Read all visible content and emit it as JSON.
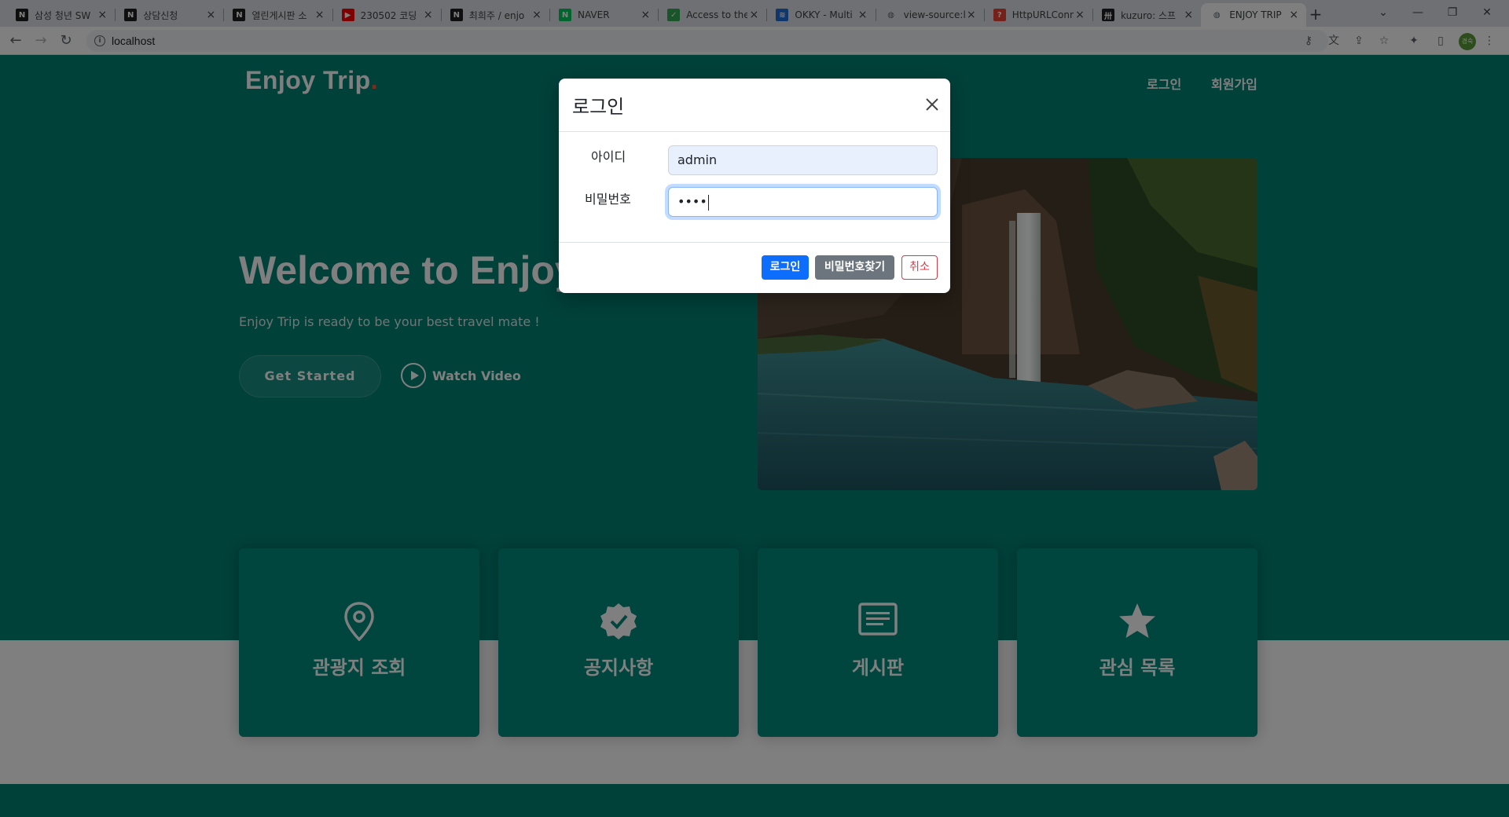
{
  "browser": {
    "tabs": [
      {
        "title": "삼성 청년 SW",
        "favicon": "notion-icon",
        "active": false
      },
      {
        "title": "상담신청",
        "favicon": "notion-icon",
        "active": false
      },
      {
        "title": "열린게시판 소",
        "favicon": "notion-icon",
        "active": false
      },
      {
        "title": "230502 코딩",
        "favicon": "youtube-icon",
        "active": false
      },
      {
        "title": "최희주 / enjo",
        "favicon": "notion-icon",
        "active": false
      },
      {
        "title": "NAVER",
        "favicon": "naver-icon",
        "active": false
      },
      {
        "title": "Access to the",
        "favicon": "check-icon",
        "active": false
      },
      {
        "title": "OKKY - Multi",
        "favicon": "okky-icon",
        "active": false
      },
      {
        "title": "view-source:l",
        "favicon": "globe-icon",
        "active": false
      },
      {
        "title": "HttpURLConn",
        "favicon": "question-icon",
        "active": false
      },
      {
        "title": "kuzuro: 스프",
        "favicon": "blog-icon",
        "active": false
      },
      {
        "title": "ENJOY TRIP",
        "favicon": "globe-icon",
        "active": true
      }
    ],
    "url": "localhost",
    "profile_initials": "경숙"
  },
  "site": {
    "brand": "Enjoy Trip",
    "brand_dot": ".",
    "nav": {
      "login": "로그인",
      "signup": "회원가입"
    }
  },
  "hero": {
    "title": "Welcome to Enjoy Trip",
    "subtitle": "Enjoy Trip is ready to be your best travel mate !",
    "get_started": "Get Started",
    "watch_video": "Watch Video"
  },
  "cards": [
    {
      "label": "관광지 조회",
      "icon": "map-pin-icon"
    },
    {
      "label": "공지사항",
      "icon": "badge-check-icon"
    },
    {
      "label": "게시판",
      "icon": "board-icon"
    },
    {
      "label": "관심 목록",
      "icon": "star-icon"
    }
  ],
  "modal": {
    "title": "로그인",
    "id_label": "아이디",
    "id_value": "admin",
    "pw_label": "비밀번호",
    "pw_value": "••••",
    "login_button": "로그인",
    "find_pw_button": "비밀번호찾기",
    "cancel_button": "취소"
  },
  "colors": {
    "primary_teal": "#008374",
    "brand_accent": "#f85a40",
    "button_primary": "#0d6efd",
    "button_secondary": "#6c757d",
    "button_danger": "#dc3545"
  }
}
